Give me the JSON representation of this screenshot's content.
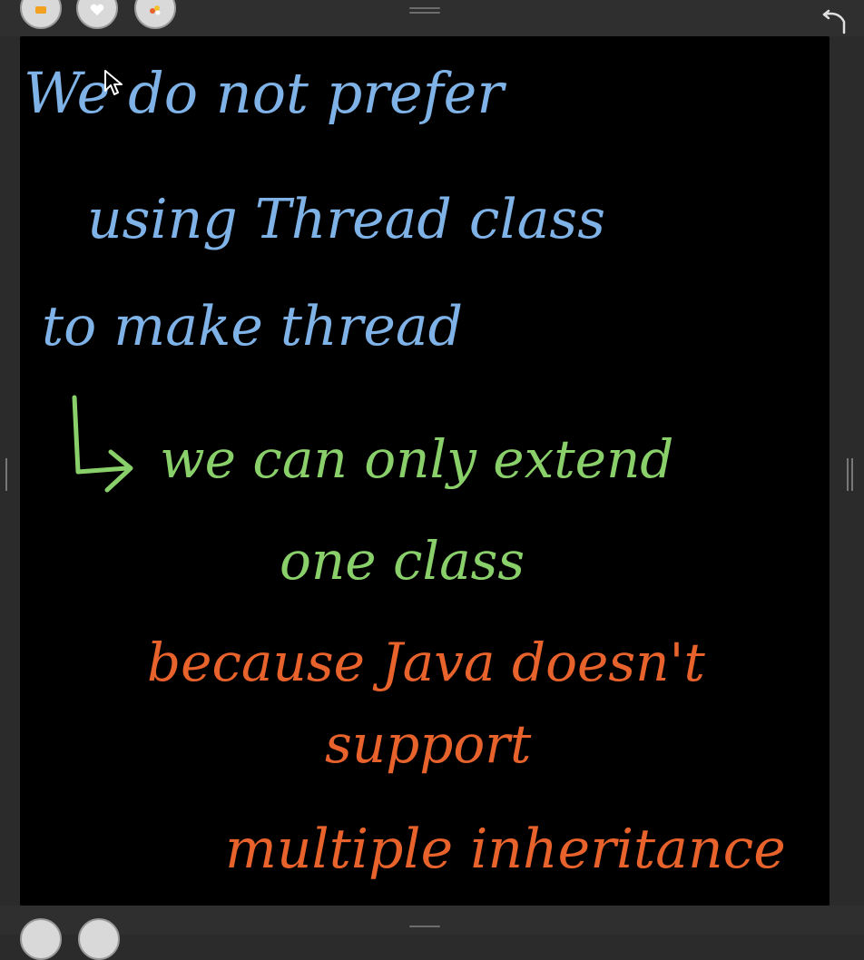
{
  "toolbar": {
    "tools": [
      {
        "icon": "pen-icon"
      },
      {
        "icon": "heart-shape-icon"
      },
      {
        "icon": "palette-icon"
      }
    ],
    "redo_icon": "redo-arrow-icon"
  },
  "colors": {
    "canvas": "#000000",
    "blue_ink": "#7fb2e6",
    "green_ink": "#8ad06a",
    "orange_ink": "#e8622c"
  },
  "notes": {
    "line1": "We do not prefer",
    "line2": "using Thread class",
    "line3": "to make thread",
    "line4": "we can only extend",
    "line5": "one class",
    "line6": "because Java doesn't",
    "line7": "support",
    "line8": "multiple inheritance"
  }
}
